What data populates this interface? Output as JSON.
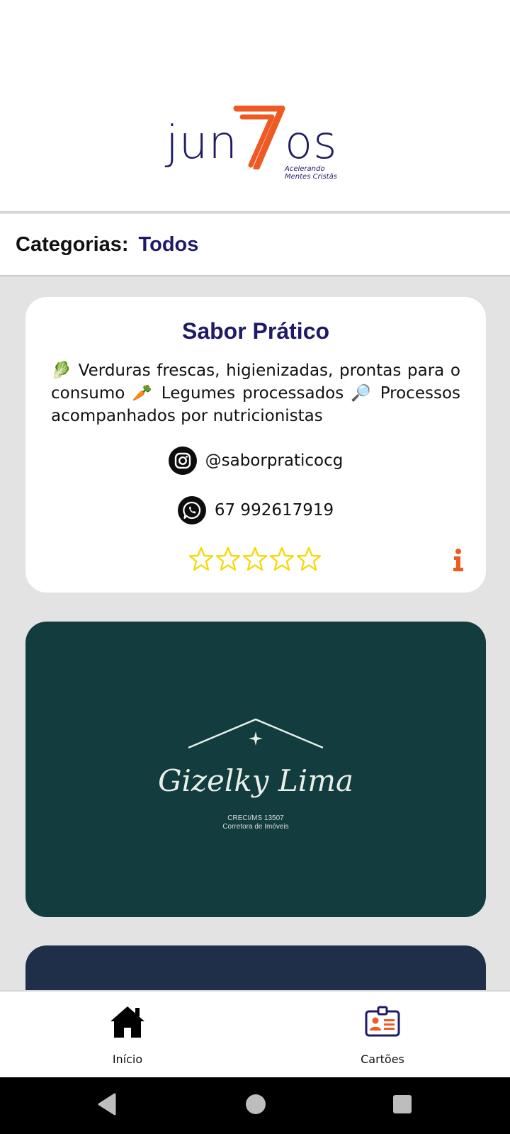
{
  "brand": {
    "logo_part1": "jun",
    "logo_part2": "os",
    "tagline_line1": "Acelerando",
    "tagline_line2": "Mentes Cristãs",
    "colors": {
      "navy": "#1e1a66",
      "orange": "#ee5a24"
    }
  },
  "categories": {
    "label": "Categorias:",
    "value": "Todos"
  },
  "cards": [
    {
      "title": "Sabor Prático",
      "description": "🥬 Verduras frescas, higienizadas, prontas para o consumo 🥕 Legumes processados 🔎 Processos acompanhados por nutricionistas",
      "instagram": "@saborpraticocg",
      "whatsapp": "67 992617919",
      "rating": {
        "value": 0,
        "max": 5
      },
      "icons": [
        "instagram-icon",
        "whatsapp-icon",
        "star-outline-icon",
        "info-icon"
      ]
    },
    {
      "name": "Gizelky Lima",
      "line1": "CRECI/MS 13507",
      "line2": "Corretora de Imóveis",
      "background": "#123c3d"
    },
    {
      "background": "#1f2f49"
    }
  ],
  "nav": {
    "home_label": "Início",
    "cards_label": "Cartões",
    "home_icon": "home-icon",
    "cards_icon": "id-card-icon"
  },
  "system_nav": [
    "back-icon",
    "home-circle-icon",
    "recents-icon"
  ]
}
